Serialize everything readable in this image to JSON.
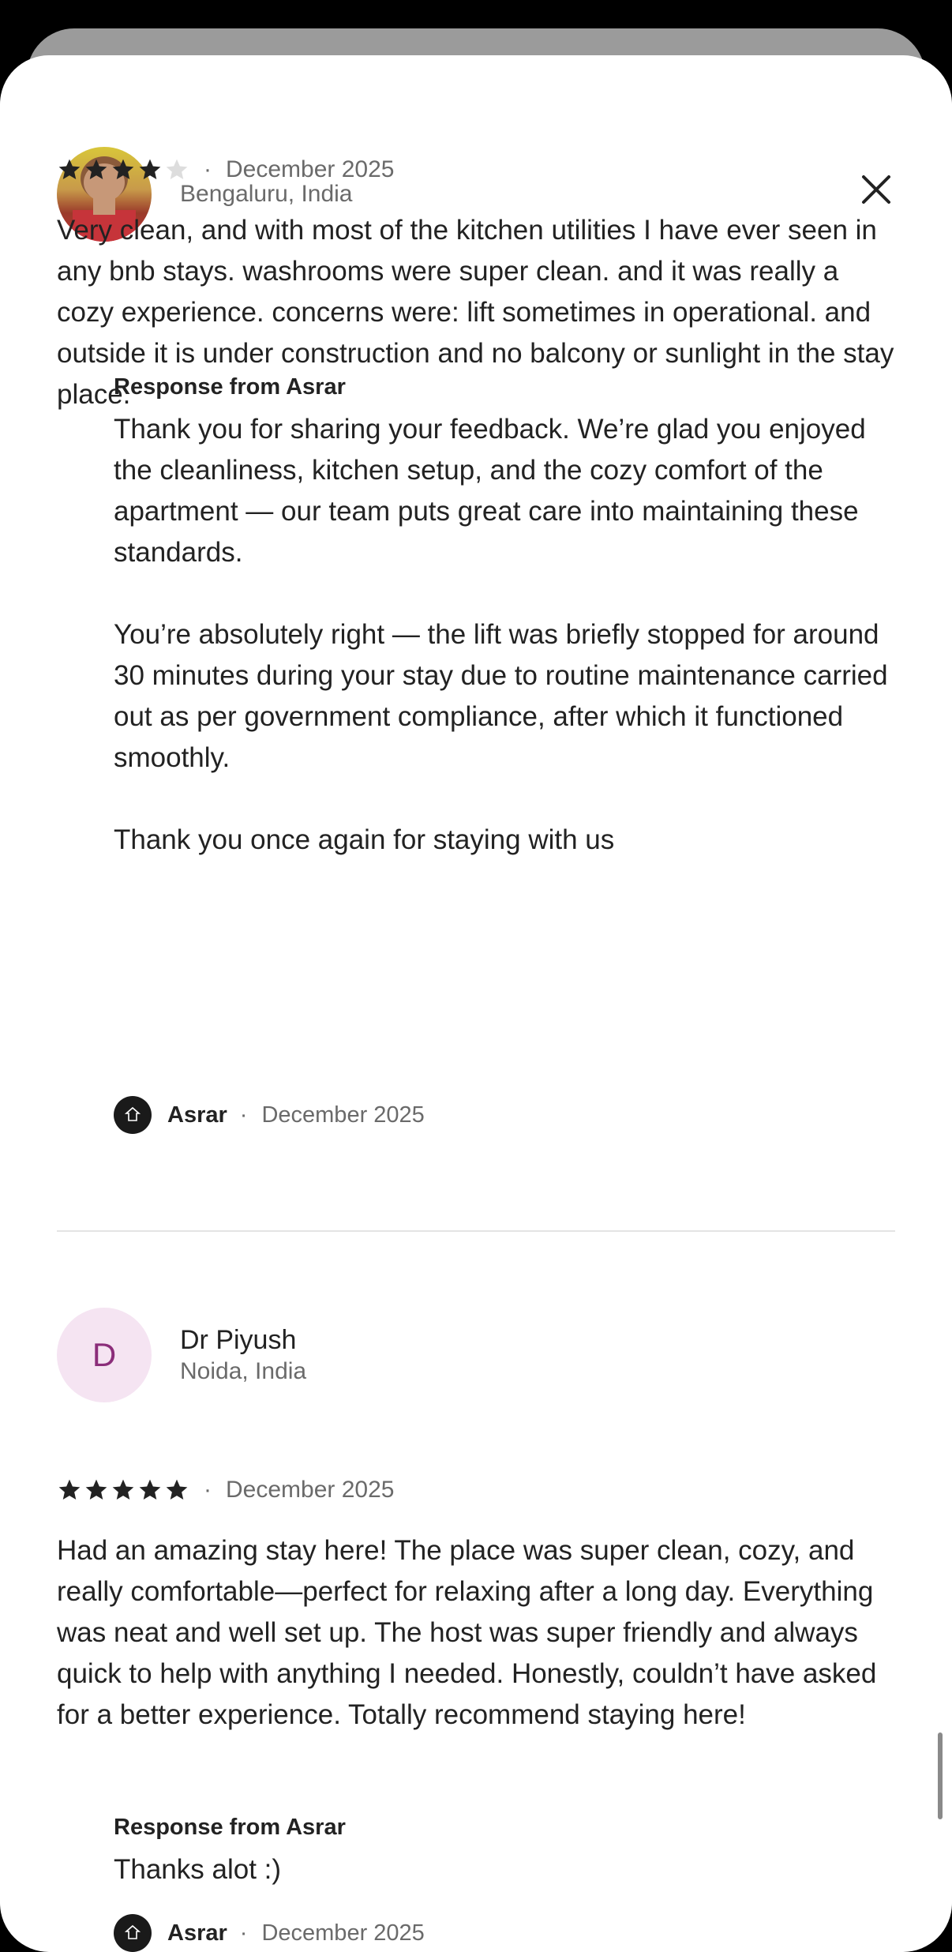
{
  "modal": {
    "close_label": "Close"
  },
  "reviews": [
    {
      "reviewer_name": "",
      "location": "Bengaluru, India",
      "rating": 4,
      "date": "December 2025",
      "text": "Very clean, and with most of the kitchen utilities I have ever seen in any bnb stays. washrooms were super clean. and it was really a cozy experience. concerns were: lift sometimes in operational. and outside it is under construction and no balcony or sunlight in the stay place.",
      "response_title": "Response from Asrar",
      "response_paragraphs": [
        "Thank you for sharing your feedback. We’re glad you enjoyed the cleanliness, kitchen setup, and the cozy comfort of the apartment — our team puts great care into maintaining these standards.",
        "You’re absolutely right — the lift was briefly stopped for around 30 minutes during your stay due to routine maintenance carried out as per government compliance, after which it functioned smoothly.",
        "Thank you once again for staying with us"
      ],
      "host_name": "Asrar",
      "host_date": "December 2025"
    },
    {
      "reviewer_name": "Dr Piyush",
      "initial": "D",
      "location": "Noida, India",
      "rating": 5,
      "date": "December 2025",
      "text": "Had an amazing stay here! The place was super clean, cozy, and really comfortable—perfect for relaxing after a long day. Everything was neat and well set up. The host was super friendly and always quick to help with anything I needed. Honestly, couldn’t have asked for a better experience. Totally recommend staying here!",
      "response_title": "Response from Asrar",
      "response_paragraphs": [
        "Thanks alot :)"
      ],
      "host_name": "Asrar",
      "host_date": "December 2025"
    }
  ],
  "separator": "·",
  "colors": {
    "star_filled": "#222222",
    "star_empty": "#dddddd",
    "muted_text": "#6a6a6a"
  },
  "icons": {
    "close": "close-icon",
    "star": "star-icon"
  }
}
